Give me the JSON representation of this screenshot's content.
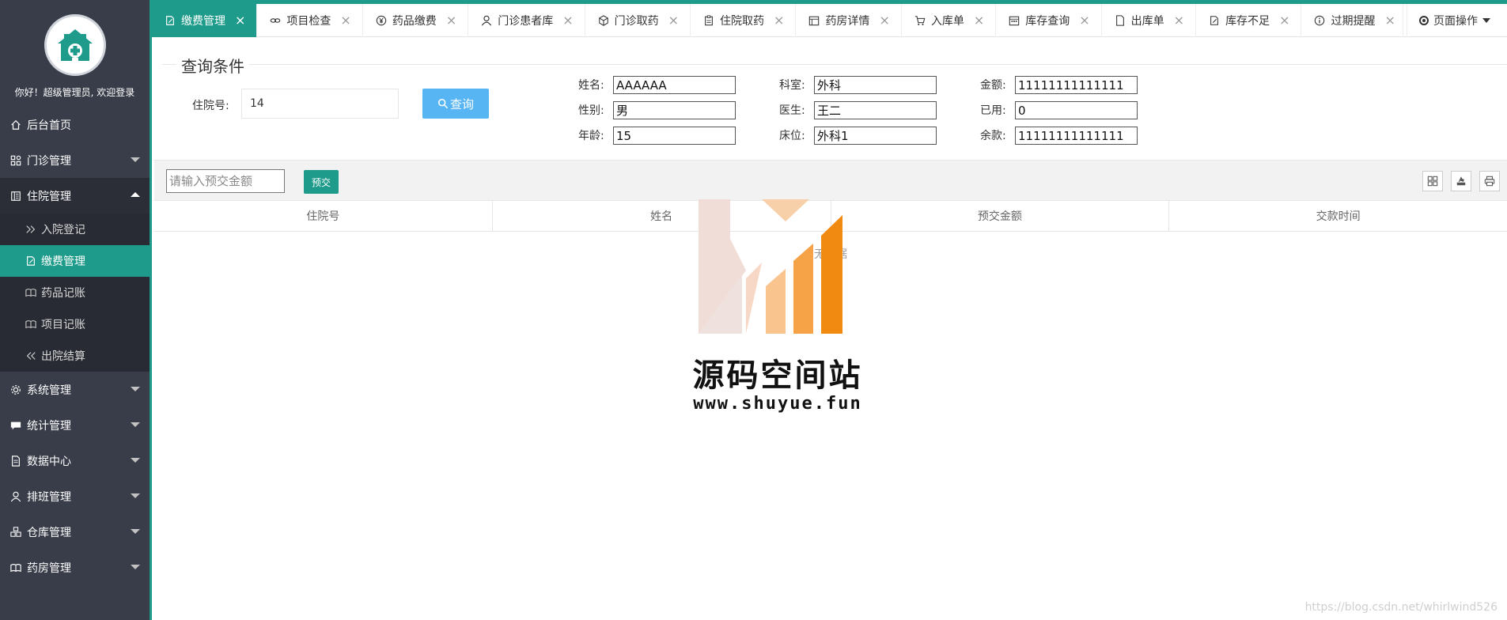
{
  "sidebar": {
    "welcome": "你好！超级管理员, 欢迎登录",
    "items": [
      {
        "label": "后台首页"
      },
      {
        "label": "门诊管理"
      },
      {
        "label": "住院管理"
      },
      {
        "label": "系统管理"
      },
      {
        "label": "统计管理"
      },
      {
        "label": "数据中心"
      },
      {
        "label": "排班管理"
      },
      {
        "label": "仓库管理"
      },
      {
        "label": "药房管理"
      }
    ],
    "sub_items": [
      {
        "label": "入院登记"
      },
      {
        "label": "缴费管理"
      },
      {
        "label": "药品记账"
      },
      {
        "label": "项目记账"
      },
      {
        "label": "出院结算"
      }
    ]
  },
  "tabs": [
    {
      "label": "缴费管理"
    },
    {
      "label": "项目检查"
    },
    {
      "label": "药品缴费"
    },
    {
      "label": "门诊患者库"
    },
    {
      "label": "门诊取药"
    },
    {
      "label": "住院取药"
    },
    {
      "label": "药房详情"
    },
    {
      "label": "入库单"
    },
    {
      "label": "库存查询"
    },
    {
      "label": "出库单"
    },
    {
      "label": "库存不足"
    },
    {
      "label": "过期提醒"
    }
  ],
  "tab_close": "×",
  "page_op": "页面操作",
  "query": {
    "legend": "查询条件",
    "hosp_label": "住院号:",
    "hosp_value": "14",
    "search_label": "查询"
  },
  "info": {
    "name_label": "姓名:",
    "name": "AAAAAA",
    "gender_label": "性别:",
    "gender": "男",
    "age_label": "年龄:",
    "age": "15",
    "dept_label": "科室:",
    "dept": "外科",
    "doctor_label": "医生:",
    "doctor": "王二",
    "bed_label": "床位:",
    "bed": "外科1",
    "amount_label": "金额:",
    "amount": "11111111111111",
    "used_label": "已用:",
    "used": "0",
    "balance_label": "余款:",
    "balance": "11111111111111"
  },
  "toolbar": {
    "amount_placeholder": "请输入预交金额",
    "pay_label": "预交"
  },
  "table": {
    "headers": [
      "住院号",
      "姓名",
      "预交金额",
      "交款时间"
    ],
    "empty_text": "无数据"
  },
  "watermark": {
    "title": "源码空间站",
    "url": "www.shuyue.fun"
  },
  "credit": "https://blog.csdn.net/whirlwind526",
  "colors": {
    "accent": "#1e9b8a",
    "sidebar_bg": "#393d49",
    "search_btn": "#56b5f2"
  }
}
